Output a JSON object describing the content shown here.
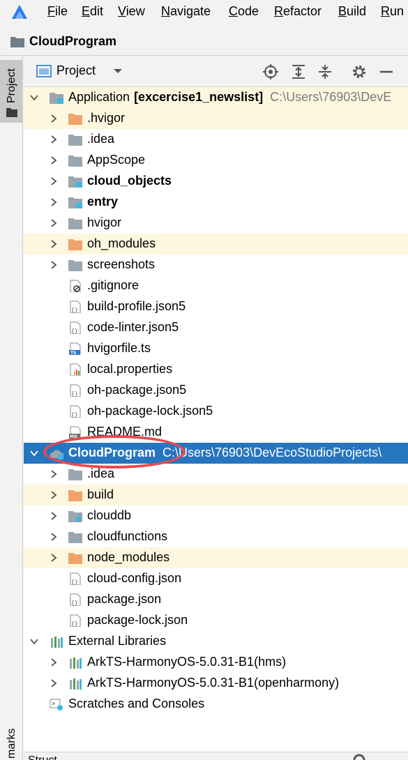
{
  "menubar": {
    "items": [
      {
        "label": "File",
        "mnemonic": "F",
        "rest": "ile"
      },
      {
        "label": "Edit",
        "mnemonic": "E",
        "rest": "dit"
      },
      {
        "label": "View",
        "mnemonic": "V",
        "rest": "iew"
      },
      {
        "label": "Navigate",
        "mnemonic": "N",
        "rest": "avigate"
      },
      {
        "label": "Code",
        "mnemonic": "C",
        "rest": "ode"
      },
      {
        "label": "Refactor",
        "mnemonic": "R",
        "rest": "efactor"
      },
      {
        "label": "Build",
        "mnemonic": "B",
        "rest": "uild"
      },
      {
        "label": "Run",
        "mnemonic": "R",
        "rest": "un"
      }
    ]
  },
  "breadcrumb": {
    "label": "CloudProgram"
  },
  "stripe": {
    "project_label": "Project",
    "bookmarks_label": "marks"
  },
  "panel": {
    "title": "Project"
  },
  "tree": [
    {
      "label": "Application",
      "bold_suffix": "[excercise1_newslist]",
      "path": "C:\\Users\\76903\\DevE"
    },
    {
      "label": ".hvigor"
    },
    {
      "label": ".idea"
    },
    {
      "label": "AppScope"
    },
    {
      "label": "cloud_objects"
    },
    {
      "label": "entry"
    },
    {
      "label": "hvigor"
    },
    {
      "label": "oh_modules"
    },
    {
      "label": "screenshots"
    },
    {
      "label": ".gitignore"
    },
    {
      "label": "build-profile.json5"
    },
    {
      "label": "code-linter.json5"
    },
    {
      "label": "hvigorfile.ts"
    },
    {
      "label": "local.properties"
    },
    {
      "label": "oh-package.json5"
    },
    {
      "label": "oh-package-lock.json5"
    },
    {
      "label": "README.md"
    },
    {
      "label": "CloudProgram",
      "path": "C:\\Users\\76903\\DevEcoStudioProjects\\"
    },
    {
      "label": ".idea"
    },
    {
      "label": "build"
    },
    {
      "label": "clouddb"
    },
    {
      "label": "cloudfunctions"
    },
    {
      "label": "node_modules"
    },
    {
      "label": "cloud-config.json"
    },
    {
      "label": "package.json"
    },
    {
      "label": "package-lock.json"
    },
    {
      "label": "External Libraries"
    },
    {
      "label": "ArkTS-HarmonyOS-5.0.31-B1(hms)"
    },
    {
      "label": "ArkTS-HarmonyOS-5.0.31-B1(openharmony)"
    },
    {
      "label": "Scratches and Consoles"
    }
  ],
  "bottom": {
    "label": "Struct"
  },
  "colors": {
    "selection": "#2675bf",
    "highlight_row": "#fdf7df",
    "folder_orange": "#f0a36b",
    "folder_gray": "#9aa7b0",
    "callout": "#e8494f"
  }
}
